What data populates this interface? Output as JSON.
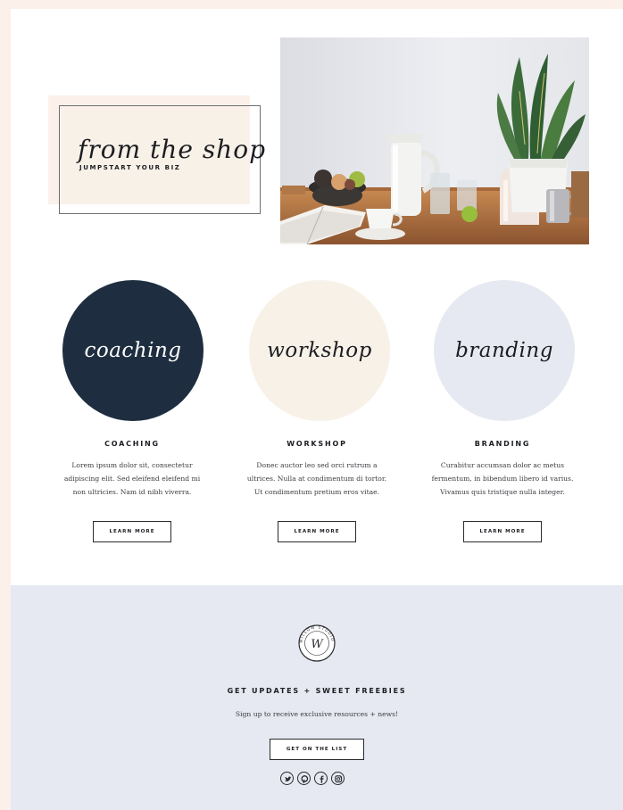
{
  "hero": {
    "title": "from the shop",
    "subtitle": "JUMPSTART YOUR BIZ"
  },
  "services": [
    {
      "circle_label": "coaching",
      "heading": "COACHING",
      "text_lines": [
        "Lorem ipsum dolor sit, consectetur",
        "adipiscing elit. Sed eleifend eleifend mi",
        "non ultricies. Nam id nibh viverra."
      ],
      "button": "LEARN MORE",
      "circle_color": "#1e2e40",
      "label_color": "#ffffff"
    },
    {
      "circle_label": "workshop",
      "heading": "WORKSHOP",
      "text_lines": [
        "Donec auctor leo sed orci rutrum a",
        "ultrices. Nulla at condimentum di tortor.",
        "Ut condimentum pretium eros vitae."
      ],
      "button": "LEARN MORE",
      "circle_color": "#f7f1e7",
      "label_color": "#1c1d22"
    },
    {
      "circle_label": "branding",
      "heading": "BRANDING",
      "text_lines": [
        "Curabitur accumsan dolor ac metus",
        "fermentum, in bibendum libero id varius.",
        "Vivamus quis tristique nulla integer."
      ],
      "button": "LEARN MORE",
      "circle_color": "#e6e9f1",
      "label_color": "#1c1d22"
    }
  ],
  "footer": {
    "logo_letter": "W",
    "logo_ring_text": "WILLOW STUDIO",
    "heading": "GET UPDATES + SWEET FREEBIES",
    "subtext": "Sign up to receive exclusive resources + news!",
    "button": "GET ON THE LIST",
    "social_icons": [
      "twitter-icon",
      "pinterest-icon",
      "facebook-icon",
      "instagram-icon"
    ]
  },
  "colors": {
    "background": "#fbf1ea",
    "navy": "#1e2e40",
    "cream": "#f7f1e7",
    "light_blue": "#e6e9f1"
  }
}
